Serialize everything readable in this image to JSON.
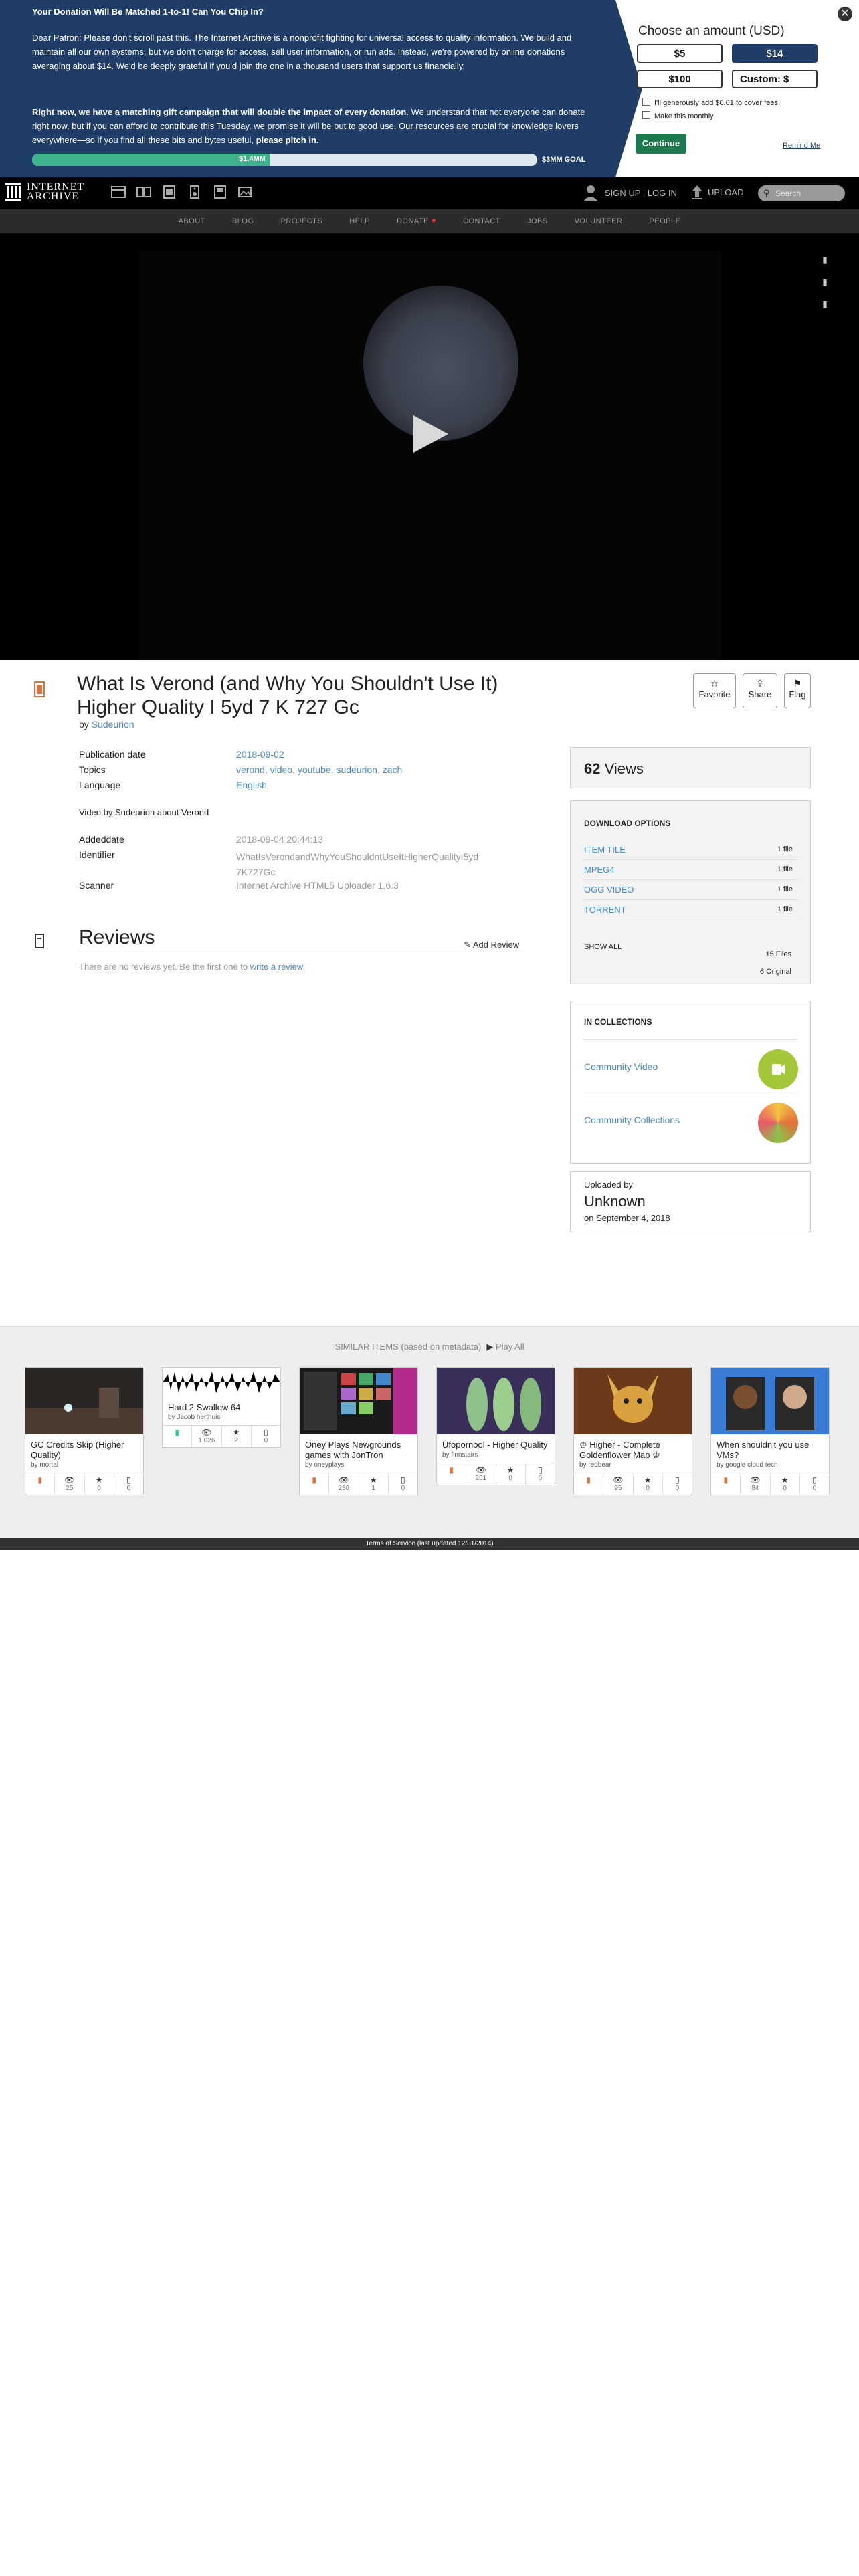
{
  "banner": {
    "title": "Your Donation Will Be Matched 1-to-1! Can You Chip In?",
    "para1": "Dear Patron: Please don't scroll past this. The Internet Archive is a nonprofit fighting for universal access to quality information. We build and maintain all our own systems, but we don't charge for access, sell user information, or run ads. Instead, we're powered by online donations averaging about $14. We'd be deeply grateful if you'd join the one in a thousand users that support us financially.",
    "para2_bold": "Right now, we have a matching gift campaign that will double the impact of every donation.",
    "para2_rest": " We understand that not everyone can donate right now, but if you can afford to contribute this Tuesday, we promise it will be put to good use. Our resources are crucial for knowledge lovers everywhere—so if you find all these bits and bytes useful, ",
    "para2_end": "please pitch in.",
    "progress_amount": "$1.4MM",
    "progress_fraction": 0.47,
    "goal": "$3MM GOAL",
    "choose_label": "Choose an amount (USD)",
    "amounts": [
      "$5",
      "$14",
      "$100",
      "Custom: $"
    ],
    "selected_amount": "$14",
    "fee_option": "I'll generously add $0.61 to cover fees.",
    "monthly_option": "Make this monthly",
    "continue_label": "Continue",
    "remind_label": "Remind Me",
    "close_label": "✕",
    "bg_color": "#1f3d66"
  },
  "topnav": {
    "logo_line1": "INTERNET",
    "logo_line2": "ARCHIVE",
    "icons": [
      "web-icon",
      "texts-icon",
      "video-icon",
      "audio-icon",
      "software-icon",
      "images-icon"
    ],
    "signup_label": "SIGN UP | LOG IN",
    "upload_label": "UPLOAD",
    "search_placeholder": "Search"
  },
  "subnav": {
    "items": [
      "ABOUT",
      "BLOG",
      "PROJECTS",
      "HELP",
      "DONATE",
      "CONTACT",
      "JOBS",
      "VOLUNTEER",
      "PEOPLE"
    ]
  },
  "item": {
    "title": "What Is Verond (and Why You Shouldn't Use It) Higher Quality I 5yd 7 K 727 Gc",
    "by_label": "by",
    "author": "Sudeurion",
    "actions": [
      "Favorite",
      "Share",
      "Flag"
    ],
    "metadata": {
      "publication_date_label": "Publication date",
      "publication_date": "2018-09-02",
      "topics_label": "Topics",
      "topics": [
        "verond",
        "video",
        "youtube",
        "sudeurion",
        "zach"
      ],
      "language_label": "Language",
      "language": "English",
      "description": "Video by Sudeurion about Verond",
      "addeddate_label": "Addeddate",
      "addeddate": "2018-09-04 20:44:13",
      "identifier_label": "Identifier",
      "identifier_line1": "WhatIsVerondandWhyYouShouldntUseItHigherQualityI5yd",
      "identifier_line2": "7K727Gc",
      "scanner_label": "Scanner",
      "scanner": "Internet Archive HTML5 Uploader 1.6.3"
    },
    "reviews": {
      "heading": "Reviews",
      "add_label": "Add Review",
      "empty_prefix": "There are no reviews yet. Be the first one to ",
      "empty_link": "write a review",
      "empty_suffix": "."
    }
  },
  "sidebar": {
    "views_count": "62",
    "views_label": "Views",
    "downloads_heading": "DOWNLOAD OPTIONS",
    "downloads": [
      {
        "name": "ITEM TILE",
        "count": "1 file"
      },
      {
        "name": "MPEG4",
        "count": "1 file"
      },
      {
        "name": "OGG VIDEO",
        "count": "1 file"
      },
      {
        "name": "TORRENT",
        "count": "1 file"
      }
    ],
    "show_all": "SHOW ALL",
    "total_files": "15 Files",
    "original_files": "6 Original",
    "collections_heading": "IN COLLECTIONS",
    "collections": [
      "Community Video",
      "Community Collections"
    ],
    "uploaded_by_label": "Uploaded by",
    "uploader": "Unknown",
    "upload_date": "on September 4, 2018"
  },
  "similar": {
    "heading": "SIMILAR ITEMS (based on metadata)",
    "play_all": "Play All",
    "cards": [
      {
        "title": "GC Credits Skip (Higher Quality)",
        "by": "by mortal",
        "type": "video",
        "stats": [
          "25",
          "0",
          "0"
        ]
      },
      {
        "title": "Hard 2 Swallow 64",
        "by": "by Jacob herthuis",
        "type": "audio",
        "stats": [
          "1,026",
          "2",
          "0"
        ]
      },
      {
        "title": "Oney Plays Newgrounds games with JonTron",
        "by": "by oneyplays",
        "type": "video",
        "stats": [
          "236",
          "1",
          "0"
        ]
      },
      {
        "title": "Ufopornool - Higher Quality",
        "by": "by finnstairs",
        "type": "video",
        "stats": [
          "201",
          "0",
          "0"
        ]
      },
      {
        "title": "♔ Higher - Complete Goldenflower Map ♔",
        "by": "by redbear",
        "type": "video",
        "stats": [
          "95",
          "0",
          "0"
        ]
      },
      {
        "title": "When shouldn't you use VMs?",
        "by": "by google cloud tech",
        "type": "video",
        "stats": [
          "84",
          "0",
          "0"
        ]
      }
    ]
  },
  "footer": {
    "text": "Terms of Service (last updated 12/31/2014)"
  }
}
